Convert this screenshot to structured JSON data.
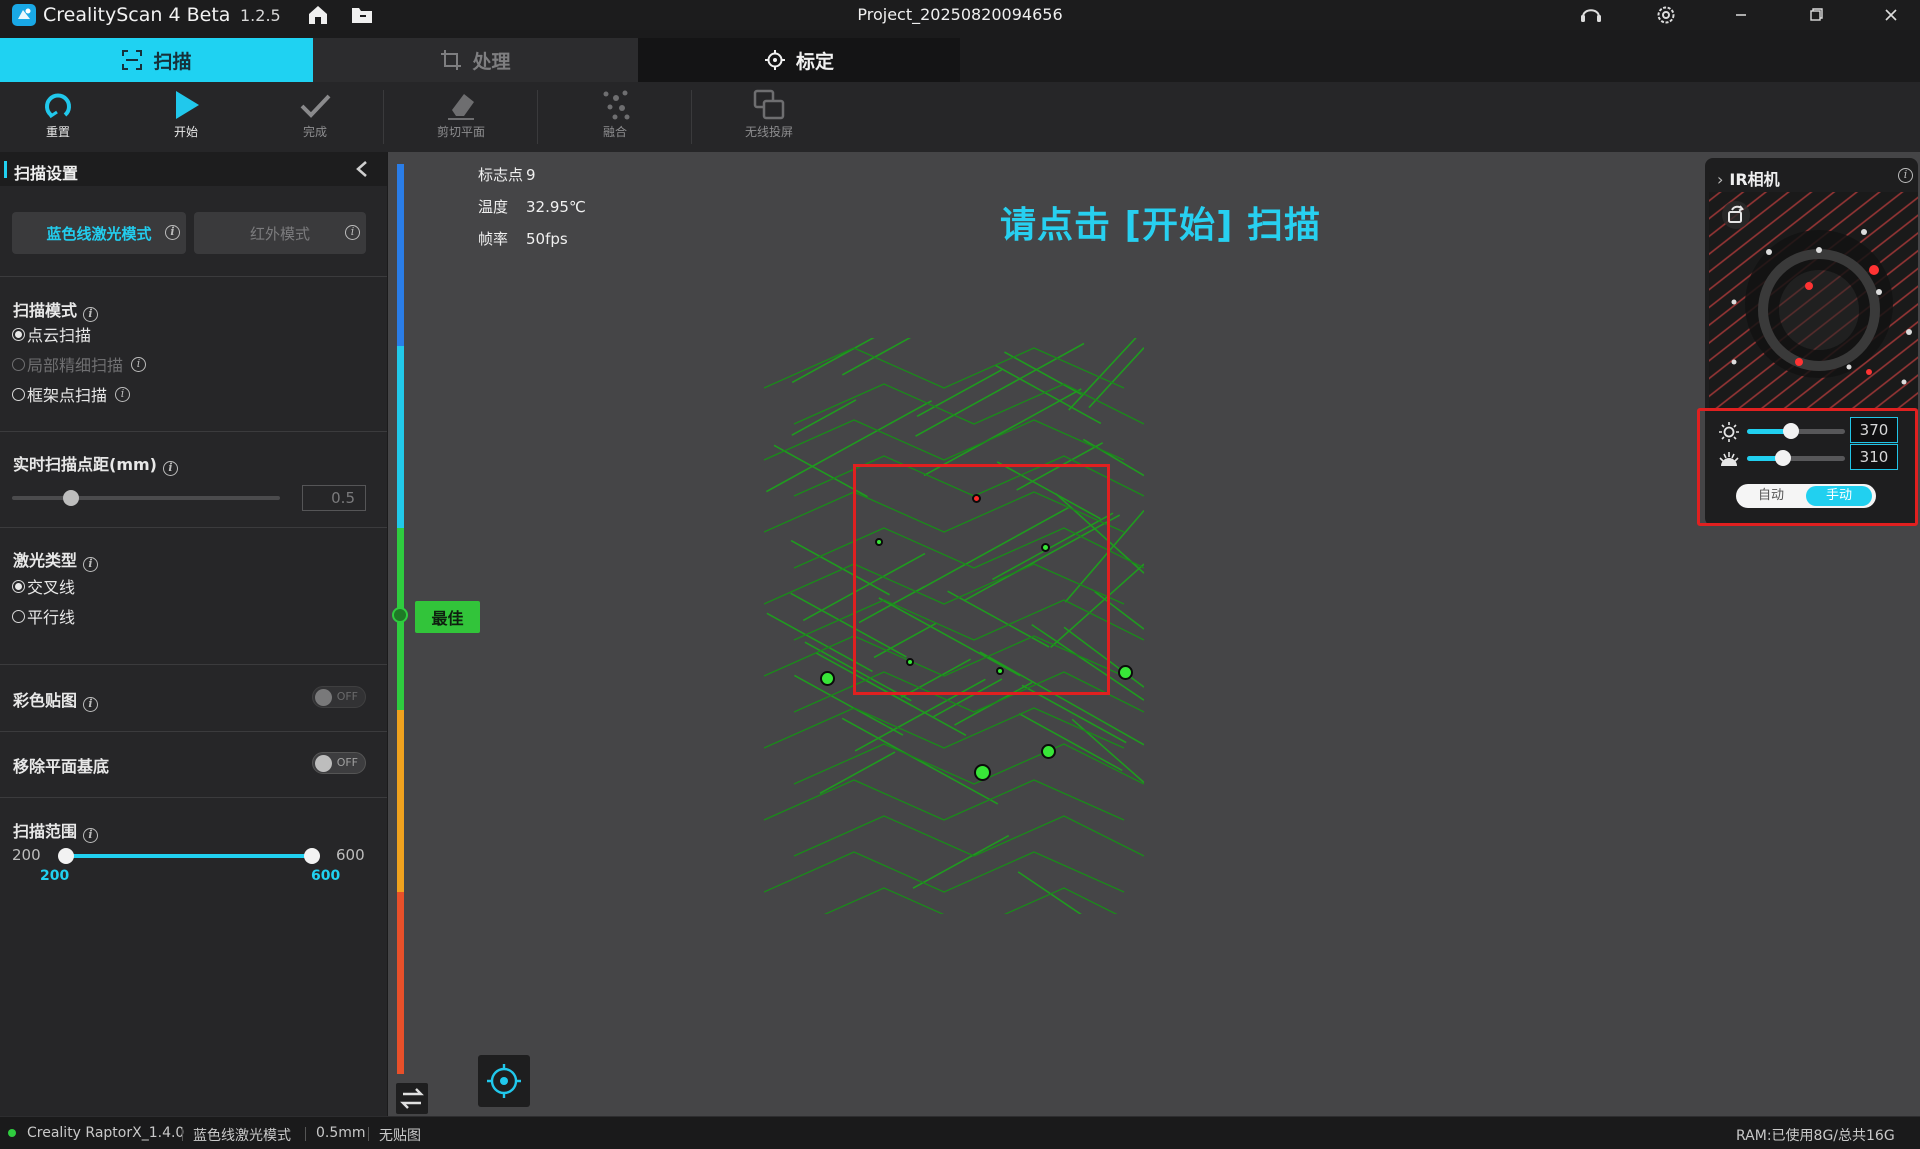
{
  "titlebar": {
    "app_name": "CrealityScan 4 Beta",
    "app_version": "1.2.5",
    "project_name": "Project_20250820094656"
  },
  "tabs": [
    {
      "label": "扫描",
      "active": true
    },
    {
      "label": "处理",
      "active": false
    },
    {
      "label": "标定",
      "active": false
    }
  ],
  "toolbar": {
    "reset": "重置",
    "start": "开始",
    "finish": "完成",
    "cut_plane": "剪切平面",
    "fuse": "融合",
    "wireless_cast": "无线投屏"
  },
  "left_panel": {
    "title": "扫描设置",
    "mode_blue": "蓝色线激光模式",
    "mode_ir": "红外模式",
    "scan_mode": {
      "title": "扫描模式",
      "options": [
        {
          "label": "点云扫描",
          "checked": true,
          "disabled": false
        },
        {
          "label": "局部精细扫描",
          "checked": false,
          "disabled": true
        },
        {
          "label": "框架点扫描",
          "checked": false,
          "disabled": false
        }
      ]
    },
    "point_distance": {
      "title": "实时扫描点距(mm)",
      "value": "0.5",
      "slider_fraction": 0.22
    },
    "laser_type": {
      "title": "激光类型",
      "options": [
        {
          "label": "交叉线",
          "checked": true
        },
        {
          "label": "平行线",
          "checked": false
        }
      ]
    },
    "color_texture": {
      "title": "彩色贴图",
      "state": "OFF"
    },
    "remove_base": {
      "title": "移除平面基底",
      "state": "OFF"
    },
    "scan_range": {
      "title": "扫描范围",
      "min": "200",
      "max": "600",
      "low": "200",
      "high": "600"
    }
  },
  "viewport": {
    "markers_label": "标志点",
    "markers_value": "9",
    "temp_label": "温度",
    "temp_value": "32.95℃",
    "fps_label": "帧率",
    "fps_value": "50fps",
    "prompt": "请点击 [开始] 扫描",
    "distance_label": "最佳",
    "distance_colors": [
      "#2a7de8",
      "#21c9ea",
      "#2fcc3f",
      "#f0a21e",
      "#e8502a"
    ]
  },
  "ir_camera": {
    "title": "IR相机",
    "brightness": "370",
    "exposure": "310",
    "brightness_fraction": 0.45,
    "exposure_fraction": 0.37,
    "mode_auto": "自动",
    "mode_manual": "手动"
  },
  "statusbar": {
    "device": "Creality RaptorX_1.4.0",
    "mode": "蓝色线激光模式",
    "point_distance": "0.5mm",
    "texture": "无贴图",
    "ram": "RAM:已使用8G/总共16G"
  }
}
